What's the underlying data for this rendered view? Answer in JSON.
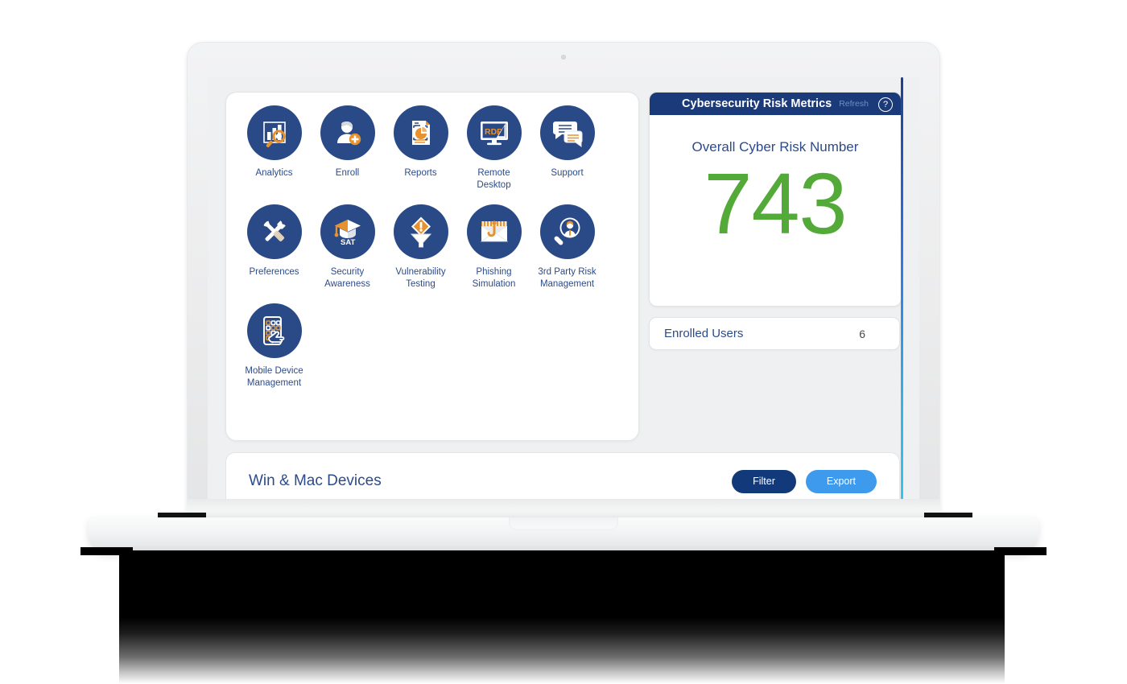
{
  "device": {
    "type": "laptop-mockup"
  },
  "app": {
    "tiles": [
      {
        "label": "Analytics",
        "icon": "analytics-chart-magnifier-icon"
      },
      {
        "label": "Enroll",
        "icon": "user-add-icon"
      },
      {
        "label": "Reports",
        "icon": "report-document-piechart-icon"
      },
      {
        "label": "Remote\nDesktop",
        "icon": "rdp-monitor-icon"
      },
      {
        "label": "Support",
        "icon": "chat-bubbles-icon"
      },
      {
        "label": "Preferences",
        "icon": "tools-wrench-screwdriver-icon"
      },
      {
        "label": "Security\nAwareness",
        "icon": "graduation-cap-sat-icon"
      },
      {
        "label": "Vulnerability\nTesting",
        "icon": "warning-funnel-icon"
      },
      {
        "label": "Phishing\nSimulation",
        "icon": "envelope-hook-icon"
      },
      {
        "label": "3rd Party Risk\nManagement",
        "icon": "magnifier-person-icon"
      },
      {
        "label": "Mobile Device\nManagement",
        "icon": "mobile-hand-icon"
      }
    ],
    "metrics_panel": {
      "title": "Cybersecurity Risk Metrics",
      "refresh_label": "Refresh",
      "help_glyph": "?",
      "risk_label": "Overall Cyber Risk Number",
      "risk_value": "743",
      "risk_color": "#53aa38",
      "header_color": "#1b3a7a"
    },
    "enrolled_users": {
      "label": "Enrolled Users",
      "count": "6"
    },
    "devices_panel": {
      "title": "Win & Mac Devices",
      "filter_label": "Filter",
      "export_label": "Export",
      "filter_color": "#123a7a",
      "export_color": "#3d9aec"
    },
    "colors": {
      "tile_bubble": "#2a4a87",
      "tile_text": "#2c4b8a",
      "accent_orange": "#e8922e",
      "screen_bg": "#eef0f1"
    }
  }
}
